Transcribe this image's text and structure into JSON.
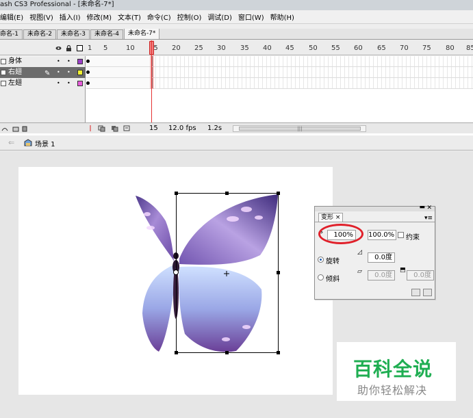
{
  "window": {
    "title": "ash CS3 Professional - [未命名-7*]"
  },
  "menu": [
    "编辑(E)",
    "视图(V)",
    "插入(I)",
    "修改(M)",
    "文本(T)",
    "命令(C)",
    "控制(O)",
    "调试(D)",
    "窗口(W)",
    "帮助(H)"
  ],
  "doc_tabs": [
    {
      "label": "命名-1"
    },
    {
      "label": "未命名-2"
    },
    {
      "label": "未命名-3"
    },
    {
      "label": "未命名-4"
    },
    {
      "label": "未命名-7*",
      "active": true
    }
  ],
  "timeline": {
    "ruler_ticks": [
      "1",
      "5",
      "10",
      "15",
      "20",
      "25",
      "30",
      "35",
      "40",
      "45",
      "50",
      "55",
      "60",
      "65",
      "70",
      "75",
      "80",
      "85"
    ],
    "current_frame_index": 15,
    "layers": [
      {
        "name": "身体",
        "color": "#9b3fc7",
        "selected": false
      },
      {
        "name": "右翅",
        "color": "#f2f230",
        "selected": true
      },
      {
        "name": "左翅",
        "color": "#e65cd9",
        "selected": false
      }
    ],
    "footer": {
      "frame": "15",
      "fps": "12.0 fps",
      "time": "1.2s"
    }
  },
  "editbar": {
    "scene": "场景 1"
  },
  "transform_panel": {
    "tab": "变形",
    "width": "100%",
    "height": "100.0%",
    "constrain": "约束",
    "rotate_label": "旋转",
    "rotate_value": "0.0度",
    "skew_label": "倾斜",
    "skew_h": "0.0度",
    "skew_v": "0.0度",
    "rotate_selected": true
  },
  "watermark": {
    "line1": "百科全说",
    "line2": "助你轻松解决"
  }
}
